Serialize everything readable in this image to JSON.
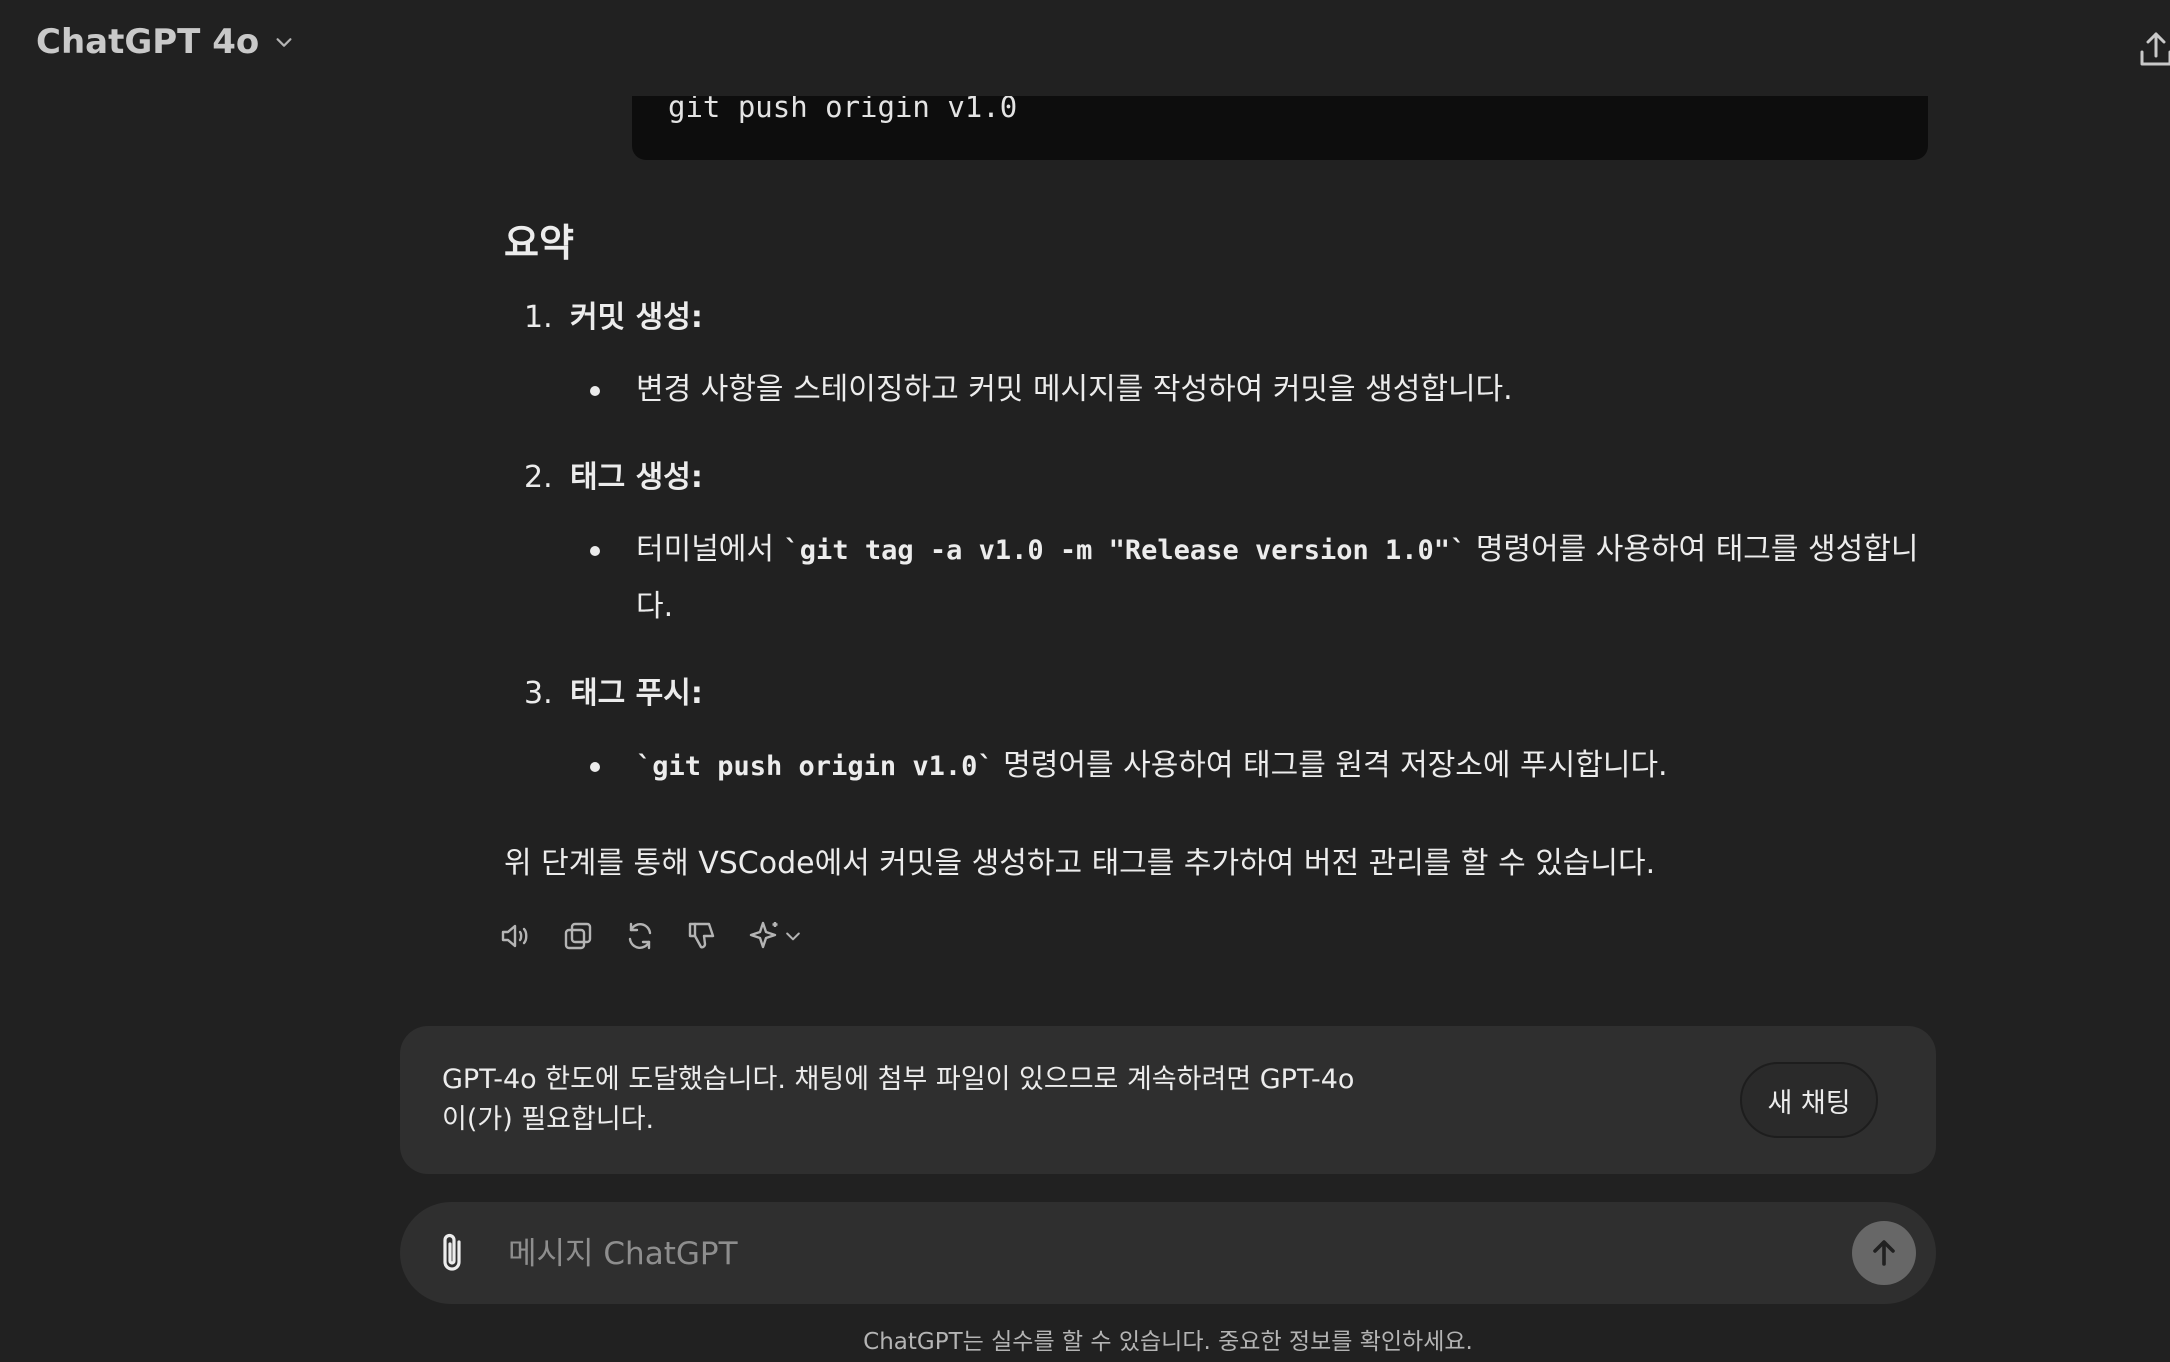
{
  "header": {
    "model_name": "ChatGPT 4o",
    "icons": {
      "model_dropdown": "chevron-down-icon",
      "share": "share-icon"
    }
  },
  "code_block": {
    "line": "git push origin v1.0"
  },
  "message": {
    "summary_heading": "요약",
    "items": [
      {
        "number": "1.",
        "title": "커밋 생성:",
        "bullet": {
          "text": "변경 사항을 스테이징하고 커밋 메시지를 작성하여 커밋을 생성합니다."
        }
      },
      {
        "number": "2.",
        "title": "태그 생성:",
        "bullet": {
          "before": "터미널에서 ",
          "code": "`git tag -a v1.0 -m \"Release version 1.0\"`",
          "after": " 명령어를 사용하여 태그를 생성합니다."
        }
      },
      {
        "number": "3.",
        "title": "태그 푸시:",
        "bullet": {
          "code": "`git push origin v1.0`",
          "after": " 명령어를 사용하여 태그를 원격 저장소에 푸시합니다."
        }
      }
    ],
    "closing": "위 단계를 통해 VSCode에서 커밋을 생성하고 태그를 추가하여 버전 관리를 할 수 있습니다."
  },
  "actions": {
    "icons": [
      "speaker-icon",
      "copy-icon",
      "regenerate-icon",
      "thumbs-down-icon",
      "sparkle-icon"
    ]
  },
  "limit_banner": {
    "text": "GPT-4o 한도에 도달했습니다. 채팅에 첨부 파일이 있으므로 계속하려면 GPT-4o 이(가) 필요합니다.",
    "new_chat_label": "새 채팅"
  },
  "composer": {
    "placeholder": "메시지 ChatGPT",
    "value": "",
    "icons": {
      "attach": "paperclip-icon",
      "send": "arrow-up-icon"
    }
  },
  "footer": {
    "disclaimer": "ChatGPT는 실수를 할 수 있습니다. 중요한 정보를 확인하세요."
  },
  "colors": {
    "background": "#212121",
    "code_background": "#0d0d0d",
    "panel": "#2f2f2f",
    "text": "#ececec",
    "muted": "#b4b4b4",
    "send_button": "#676767"
  }
}
